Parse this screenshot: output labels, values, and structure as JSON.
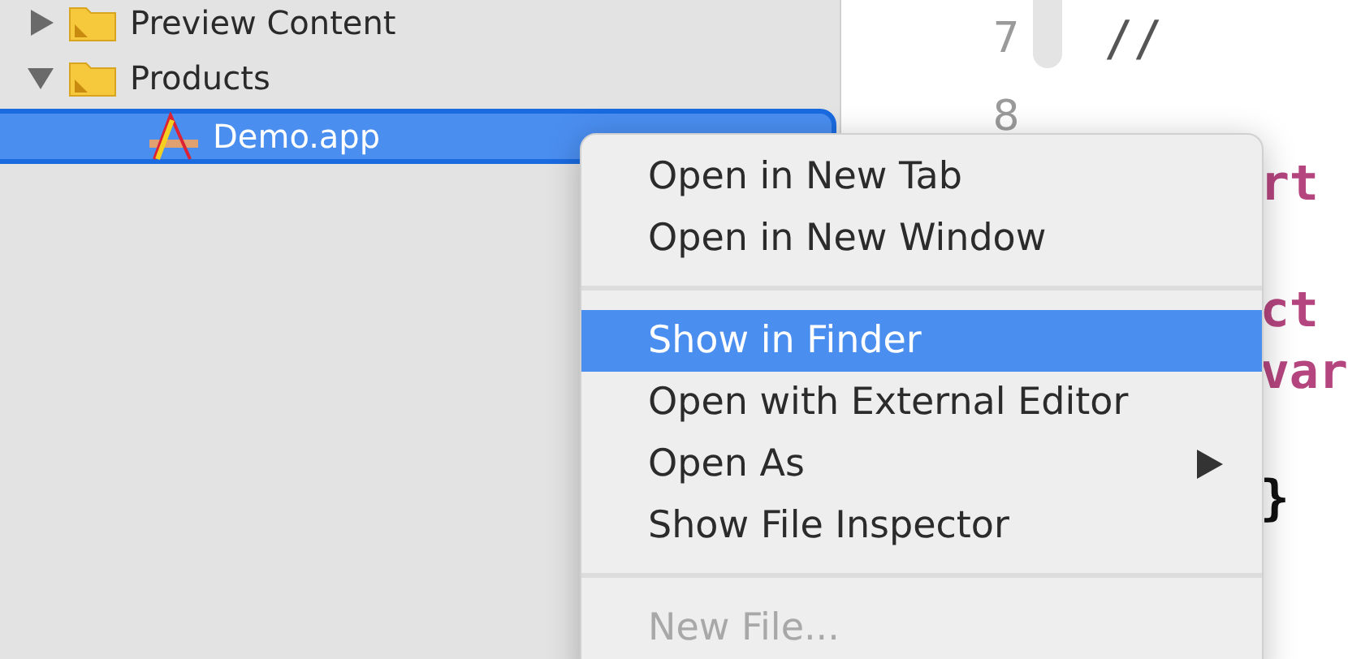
{
  "navigator": {
    "items": [
      {
        "label": "Preview Content",
        "kind": "folder",
        "expanded": false,
        "selected": false
      },
      {
        "label": "Products",
        "kind": "folder",
        "expanded": true,
        "selected": false,
        "children": [
          {
            "label": "Demo.app",
            "kind": "app",
            "selected": true
          }
        ]
      }
    ]
  },
  "editor": {
    "lines": [
      {
        "number": "7",
        "code": "//"
      },
      {
        "number": "8"
      }
    ],
    "fragments": [
      {
        "text": "rt",
        "kind": "keyword"
      },
      {
        "kind": "blank"
      },
      {
        "text": "ct",
        "kind": "keyword"
      },
      {
        "text": "var",
        "kind": "keyword"
      },
      {
        "kind": "blank"
      },
      {
        "text": "}",
        "kind": "plain"
      }
    ]
  },
  "context_menu": {
    "groups": [
      [
        {
          "label": "Open in New Tab",
          "selected": false,
          "disabled": false
        },
        {
          "label": "Open in New Window",
          "selected": false,
          "disabled": false
        }
      ],
      [
        {
          "label": "Show in Finder",
          "selected": true,
          "disabled": false
        },
        {
          "label": "Open with External Editor",
          "selected": false,
          "disabled": false
        },
        {
          "label": "Open As",
          "selected": false,
          "disabled": false,
          "submenu": true
        },
        {
          "label": "Show File Inspector",
          "selected": false,
          "disabled": false
        }
      ],
      [
        {
          "label": "New File...",
          "selected": false,
          "disabled": true
        }
      ]
    ]
  }
}
